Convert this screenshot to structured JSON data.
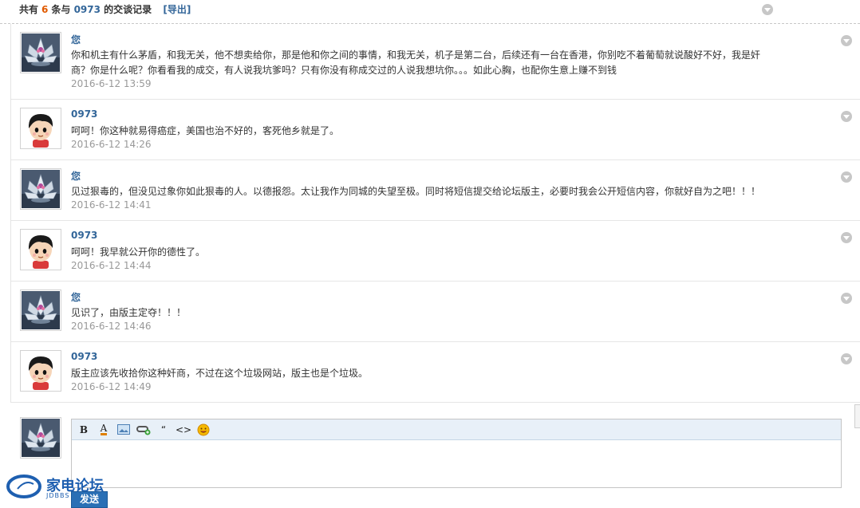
{
  "header": {
    "prefix": "共有",
    "count": "6",
    "mid": "条与",
    "partner": "0973",
    "suffix": "的交谈记录",
    "export_label": "[导出]"
  },
  "messages": [
    {
      "author": "您",
      "avatar": "lotus",
      "text": "你和机主有什么茅盾，和我无关，他不想卖给你，那是他和你之间的事情，和我无关，机子是第二台，后续还有一台在香港，你别吃不着葡萄就说酸好不好，我是奸商？你是什么呢？你看看我的成交，有人说我坑爹吗？只有你没有称成交过的人说我想坑你。。。如此心胸，也配你生意上赚不到钱",
      "time": "2016-6-12 13:59"
    },
    {
      "author": "0973",
      "avatar": "cartoon-boy",
      "text": "呵呵！你这种就易得癌症，美国也治不好的，客死他乡就是了。",
      "time": "2016-6-12 14:26"
    },
    {
      "author": "您",
      "avatar": "lotus",
      "text": "见过狠毒的，但没见过象你如此狠毒的人。以德报怨。太让我作为同城的失望至极。同时将短信提交给论坛版主，必要时我会公开短信内容，你就好自为之吧！！！",
      "time": "2016-6-12 14:41"
    },
    {
      "author": "0973",
      "avatar": "cartoon-boy",
      "text": "呵呵！我早就公开你的德性了。",
      "time": "2016-6-12 14:44"
    },
    {
      "author": "您",
      "avatar": "lotus",
      "text": "见识了，由版主定夺！！！",
      "time": "2016-6-12 14:46"
    },
    {
      "author": "0973",
      "avatar": "cartoon-boy",
      "text": "版主应该先收拾你这种奸商，不过在这个垃圾网站，版主也是个垃圾。",
      "time": "2016-6-12 14:49"
    }
  ],
  "compose": {
    "toolbar": [
      "B",
      "A",
      "image",
      "link",
      "“",
      "<>",
      "smiley"
    ],
    "send_label": "发送"
  },
  "watermark": {
    "text": "家电论坛",
    "sub": "JDBBS"
  },
  "colors": {
    "accent": "#336699",
    "count": "#e05a00",
    "send_button": "#2a6fb5"
  }
}
